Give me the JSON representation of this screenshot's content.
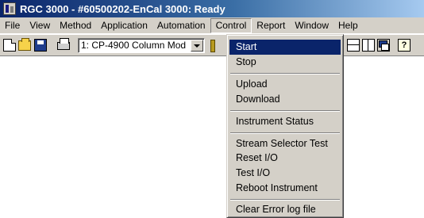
{
  "window": {
    "title": "RGC 3000  - #60500202-EnCal 3000: Ready"
  },
  "menubar": {
    "items": [
      "File",
      "View",
      "Method",
      "Application",
      "Automation",
      "Control",
      "Report",
      "Window",
      "Help"
    ],
    "active": "Control"
  },
  "toolbar": {
    "column_select": {
      "value": "1: CP-4900 Column Mod"
    },
    "icons": [
      "new-icon",
      "open-icon",
      "save-icon",
      "print-icon",
      "tile-horizontal-icon",
      "tile-vertical-icon",
      "cascade-icon",
      "help-icon"
    ],
    "help_glyph": "?"
  },
  "control_menu": {
    "items": [
      {
        "label": "Start",
        "highlighted": true
      },
      {
        "label": "Stop"
      },
      {
        "label": "Upload"
      },
      {
        "label": "Download"
      },
      {
        "label": "Instrument Status"
      },
      {
        "label": "Stream Selector Test"
      },
      {
        "label": "Reset I/O"
      },
      {
        "label": "Test I/O"
      },
      {
        "label": "Reboot Instrument"
      },
      {
        "label": "Clear Error log file"
      }
    ]
  },
  "colors": {
    "titlebar": "#0a246a",
    "highlight": "#0a246a",
    "face": "#d4d0c8"
  }
}
